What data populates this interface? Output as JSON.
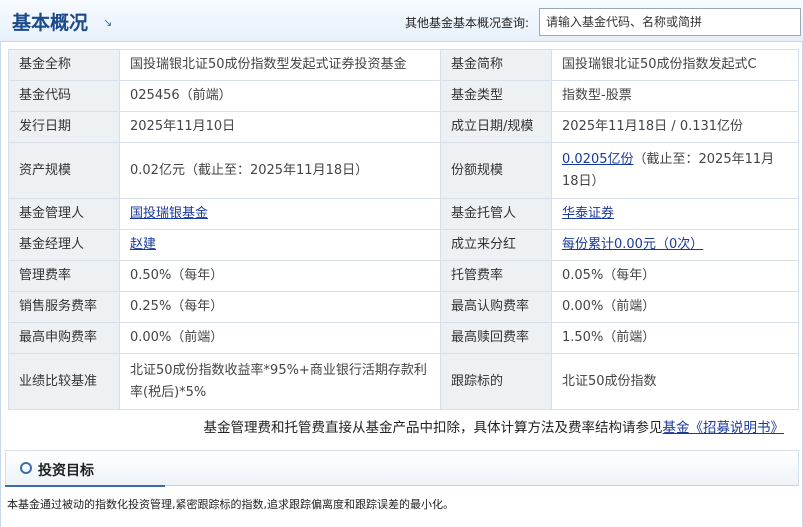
{
  "header": {
    "title": "基本概况",
    "search_label": "其他基金基本概况查询:",
    "search_placeholder": "请输入基金代码、名称或简拼"
  },
  "fund_info": {
    "rows": [
      {
        "k1": "基金全称",
        "v1": "国投瑞银北证50成份指数型发起式证券投资基金",
        "k2": "基金简称",
        "v2": "国投瑞银北证50成份指数发起式C"
      },
      {
        "k1": "基金代码",
        "v1": "025456（前端）",
        "k2": "基金类型",
        "v2": "指数型-股票"
      },
      {
        "k1": "发行日期",
        "v1": "2025年11月10日",
        "k2": "成立日期/规模",
        "v2": "2025年11月18日 / 0.131亿份"
      },
      {
        "k1": "资产规模",
        "v1": "0.02亿元（截止至：2025年11月18日）",
        "k2": "份额规模",
        "v2_link": "0.0205亿份",
        "v2_rest": "（截止至：2025年11月18日）"
      },
      {
        "k1": "基金管理人",
        "v1_link": "国投瑞银基金",
        "k2": "基金托管人",
        "v2_link": "华泰证券"
      },
      {
        "k1": "基金经理人",
        "v1_link": "赵建",
        "k2": "成立来分红",
        "v2_link": "每份累计0.00元（0次）"
      },
      {
        "k1": "管理费率",
        "v1": "0.50%（每年）",
        "k2": "托管费率",
        "v2": "0.05%（每年）"
      },
      {
        "k1": "销售服务费率",
        "v1": "0.25%（每年）",
        "k2": "最高认购费率",
        "v2": "0.00%（前端）"
      },
      {
        "k1": "最高申购费率",
        "v1": "0.00%（前端）",
        "k2": "最高赎回费率",
        "v2": "1.50%（前端）"
      },
      {
        "k1": "业绩比较基准",
        "v1": "北证50成份指数收益率*95%+商业银行活期存款利率(税后)*5%",
        "k2": "跟踪标的",
        "v2": "北证50成份指数"
      }
    ]
  },
  "fee_note": {
    "text": "基金管理费和托管费直接从基金产品中扣除，具体计算方法及费率结构请参见",
    "link": "基金《招募说明书》"
  },
  "objective": {
    "title": "投资目标",
    "text": "本基金通过被动的指数化投资管理,紧密跟踪标的指数,追求跟踪偏离度和跟踪误差的最小化。"
  }
}
